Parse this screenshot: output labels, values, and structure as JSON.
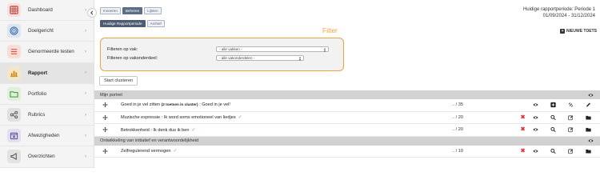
{
  "sidebar": {
    "items": [
      {
        "label": "Dashboard",
        "icon": "grid-icon",
        "bg": "#f7e0e0",
        "fg": "#c0392b",
        "active": false
      },
      {
        "label": "Doelgericht",
        "icon": "target-icon",
        "bg": "#dbe6f3",
        "fg": "#3867a8",
        "active": false
      },
      {
        "label": "Genormeerde testen",
        "icon": "list-icon",
        "bg": "#f9ddd7",
        "fg": "#d35440",
        "active": false
      },
      {
        "label": "Rapport",
        "icon": "bar-chart-icon",
        "bg": "#f6e6c8",
        "fg": "#c98a1c",
        "active": true
      },
      {
        "label": "Portfolio",
        "icon": "folder-icon",
        "bg": "#dff0d8",
        "fg": "#3f8f3f",
        "active": false
      },
      {
        "label": "Rubrics",
        "icon": "share-icon",
        "bg": "#e0e0e0",
        "fg": "#555555",
        "active": false
      },
      {
        "label": "Afwezigheden",
        "icon": "calendar-x-icon",
        "bg": "#e4dff0",
        "fg": "#5d4b8f",
        "active": false
      },
      {
        "label": "Overzichten",
        "icon": "megaphone-icon",
        "bg": "#e2e2e2",
        "fg": "#555555",
        "active": false
      }
    ],
    "chevron": "›"
  },
  "tabs": [
    "Invoeren",
    "Beheren",
    "Lijsten"
  ],
  "active_tab": "Beheren",
  "subtabs": [
    "Huidige Rapportperiode",
    "Archief"
  ],
  "active_subtab": "Huidige Rapportperiode",
  "period": {
    "line1": "Huidige rapportperiode: Periode 1",
    "line2": "01/09/2024 - 31/12/2024"
  },
  "new_test_label": "NIEUWE TOETS",
  "filter": {
    "title": "Filter",
    "vak_label": "Filteren op vak:",
    "vak_value": "- alle vakken -",
    "onderdeel_label": "Filteren op vakonderdeel:",
    "onderdeel_value": "- alle vakonderdelen -"
  },
  "start_button": "Start clusteren",
  "sections": [
    {
      "title": "Mijn portret",
      "rows": [
        {
          "prefix": "Goed in je vel zitten ",
          "badge": "(2 toetsen in cluster)",
          "suffix": " : Goed in je vel!",
          "check": false,
          "score": ".. / 35",
          "icons": [
            "eye",
            "plus-square",
            "unlink",
            "pencil"
          ],
          "delete": false
        },
        {
          "prefix": "Muzische expressie : Ik word soms emotioneel van liedjes",
          "badge": "",
          "suffix": "",
          "check": true,
          "score": ".. / 20",
          "icons": [
            "eye",
            "search",
            "edit",
            "folder"
          ],
          "delete": true
        },
        {
          "prefix": "Betrokkenheid : Ik denk dus ik ben",
          "badge": "",
          "suffix": "",
          "check": true,
          "score": ".. / 20",
          "icons": [
            "eye",
            "search",
            "edit",
            "folder"
          ],
          "delete": true
        }
      ]
    },
    {
      "title": "Ontwikkeling van initiatief en verantwoordelijkheid",
      "rows": [
        {
          "prefix": "Zelfregulerend vermogen",
          "badge": "",
          "suffix": "",
          "check": true,
          "score": ".. / 10",
          "icons": [
            "eye",
            "search",
            "edit",
            "folder"
          ],
          "delete": true
        }
      ]
    }
  ],
  "colors": {
    "accent": "#f2a23c",
    "delete": "#e0343a",
    "check": "#6cbf6c"
  }
}
